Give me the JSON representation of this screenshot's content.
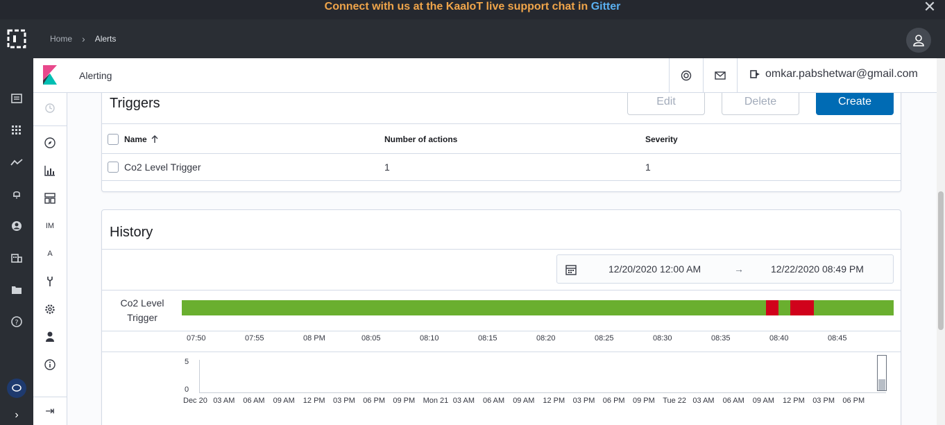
{
  "banner": {
    "text": "Connect with us at the KaaIoT live support chat in",
    "link": "Gitter"
  },
  "breadcrumb": {
    "home": "Home",
    "current": "Alerts"
  },
  "header": {
    "app_title": "Alerting",
    "user_email": "omkar.pabshetwar@gmail.com"
  },
  "kibana_nav": {
    "im_label": "IM",
    "a_label": "A"
  },
  "triggers": {
    "title": "Triggers",
    "edit_label": "Edit",
    "delete_label": "Delete",
    "create_label": "Create",
    "columns": {
      "name": "Name",
      "actions": "Number of actions",
      "severity": "Severity"
    },
    "rows": [
      {
        "name": "Co2 Level Trigger",
        "actions": "1",
        "severity": "1"
      }
    ]
  },
  "history": {
    "title": "History",
    "date_start": "12/20/2020 12:00 AM",
    "date_end": "12/22/2020 08:49 PM",
    "date_arrow": "→",
    "trigger_label": "Co2 Level Trigger",
    "timeline_ticks": [
      "07:50",
      "07:55",
      "08 PM",
      "08:05",
      "08:10",
      "08:15",
      "08:20",
      "08:25",
      "08:30",
      "08:35",
      "08:40",
      "08:45"
    ],
    "mini_y_ticks": [
      "5",
      "0"
    ],
    "mini_x_ticks": [
      "Dec 20",
      "03 AM",
      "06 AM",
      "09 AM",
      "12 PM",
      "03 PM",
      "06 PM",
      "09 PM",
      "Mon 21",
      "03 AM",
      "06 AM",
      "09 AM",
      "12 PM",
      "03 PM",
      "06 PM",
      "09 PM",
      "Tue 22",
      "03 AM",
      "06 AM",
      "09 AM",
      "12 PM",
      "03 PM",
      "06 PM"
    ],
    "colors": {
      "ok": "#6aaf2f",
      "alert": "#d0021b"
    }
  }
}
